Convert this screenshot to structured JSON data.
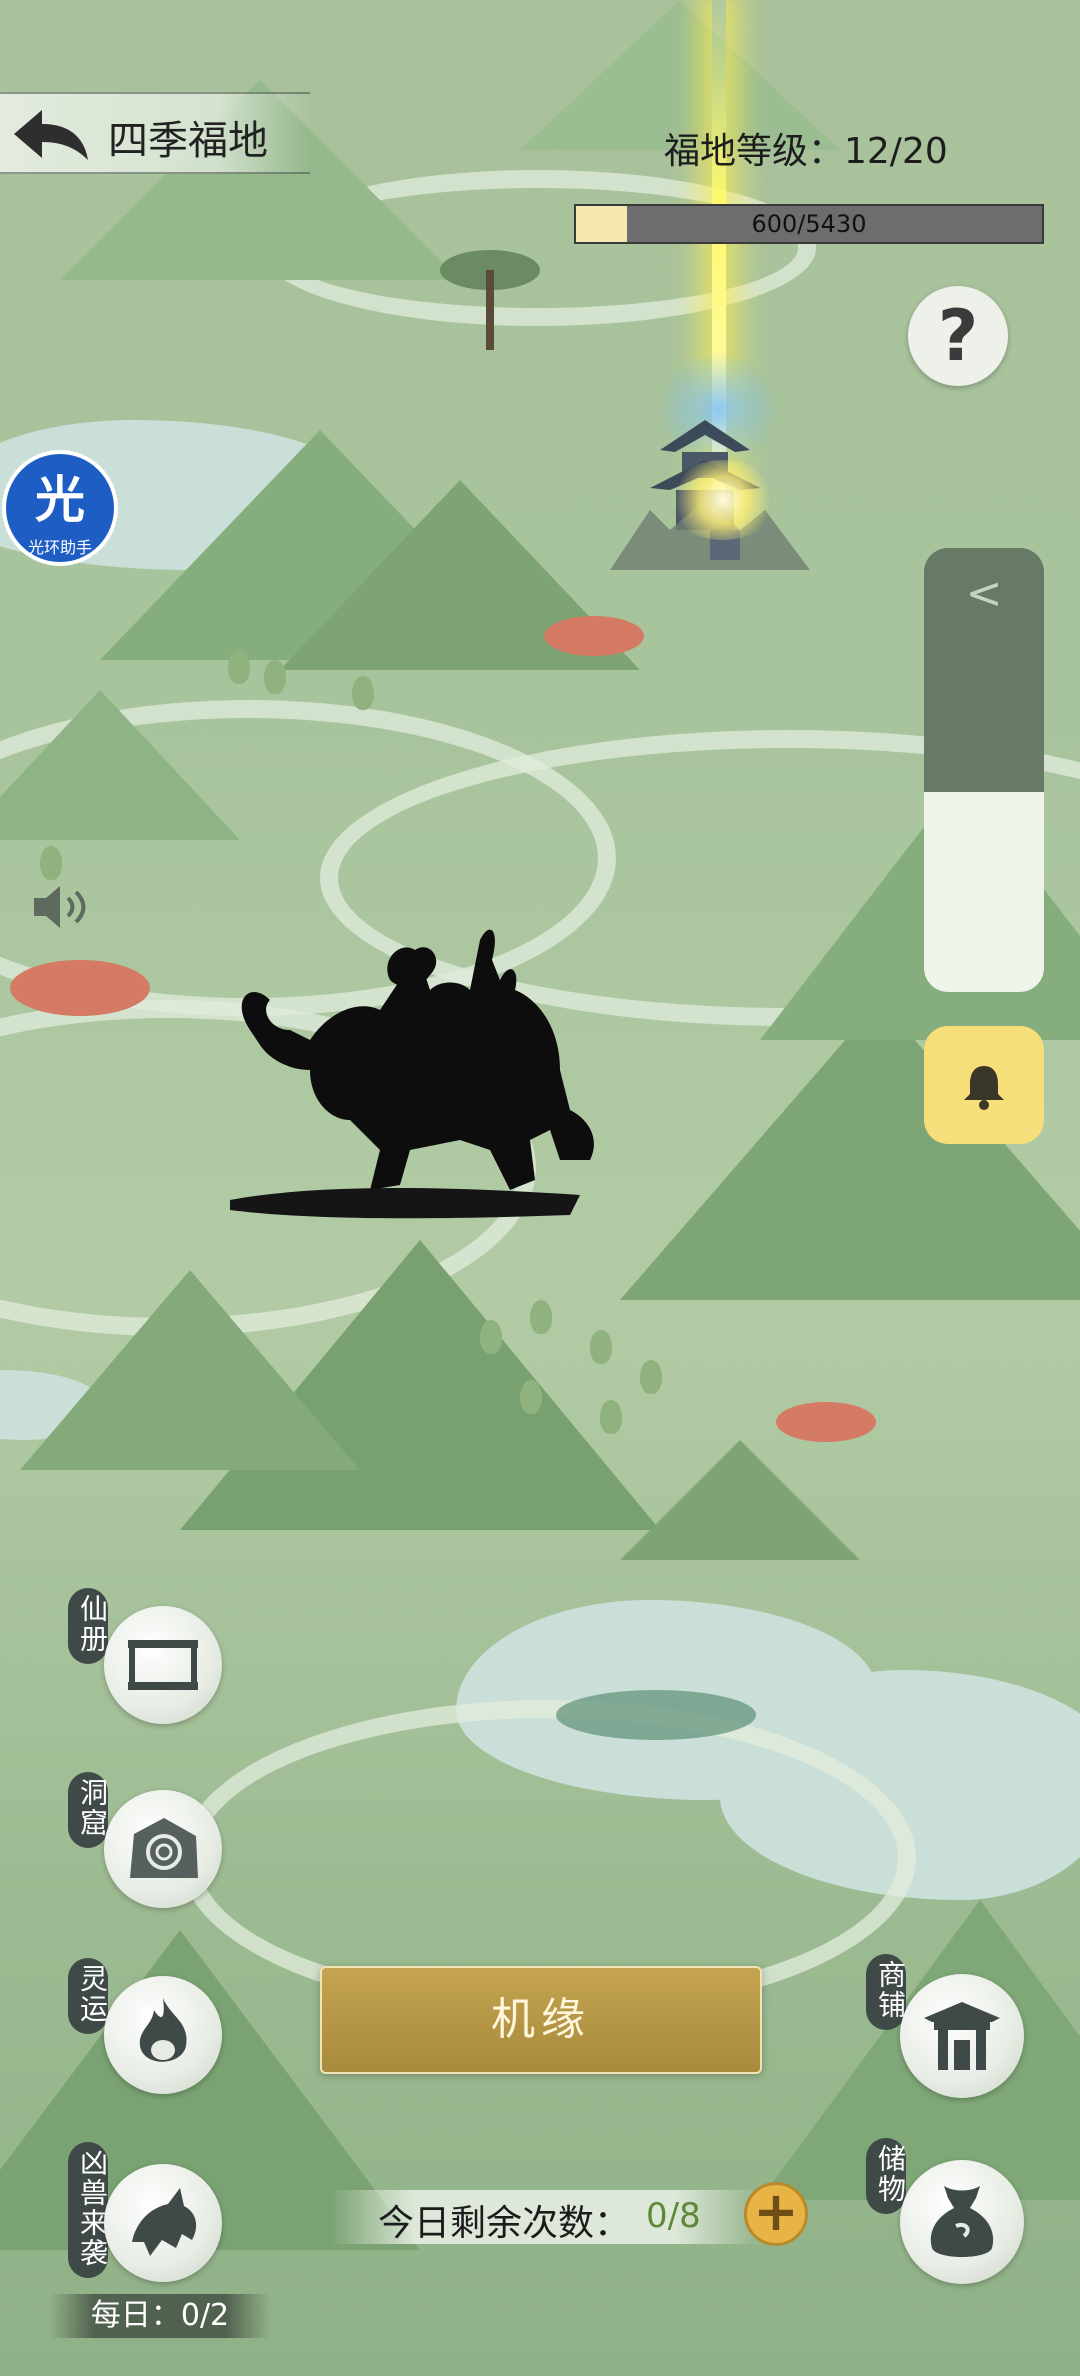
{
  "header": {
    "title": "四季福地",
    "level_label": "福地等级：12/20",
    "exp_text": "600/5430",
    "exp_fraction": 0.11
  },
  "assistant": {
    "glyph": "光",
    "label": "光环助手"
  },
  "volume": {
    "level_fraction": 0.45,
    "collapse_glyph": "<"
  },
  "help_glyph": "?",
  "left_menu": [
    {
      "label": "仙册",
      "icon": "scroll-frame-icon"
    },
    {
      "label": "洞窟",
      "icon": "cave-icon"
    },
    {
      "label": "灵运",
      "icon": "spirit-flame-icon"
    },
    {
      "label": "凶兽来袭",
      "icon": "beast-icon"
    }
  ],
  "daily_text": "每日：0/2",
  "right_menu": [
    {
      "label": "商铺",
      "icon": "shop-gate-icon"
    },
    {
      "label": "储物",
      "icon": "storage-bag-icon"
    }
  ],
  "action": {
    "button_label": "机缘",
    "remain_label": "今日剩余次数：",
    "remain_value": "0/8",
    "plus_glyph": "+"
  },
  "colors": {
    "accent_gold": "#c4a450",
    "bell_yellow": "#f6df7a",
    "assist_blue": "#1d5dc4",
    "remain_green": "#5e8a38"
  }
}
